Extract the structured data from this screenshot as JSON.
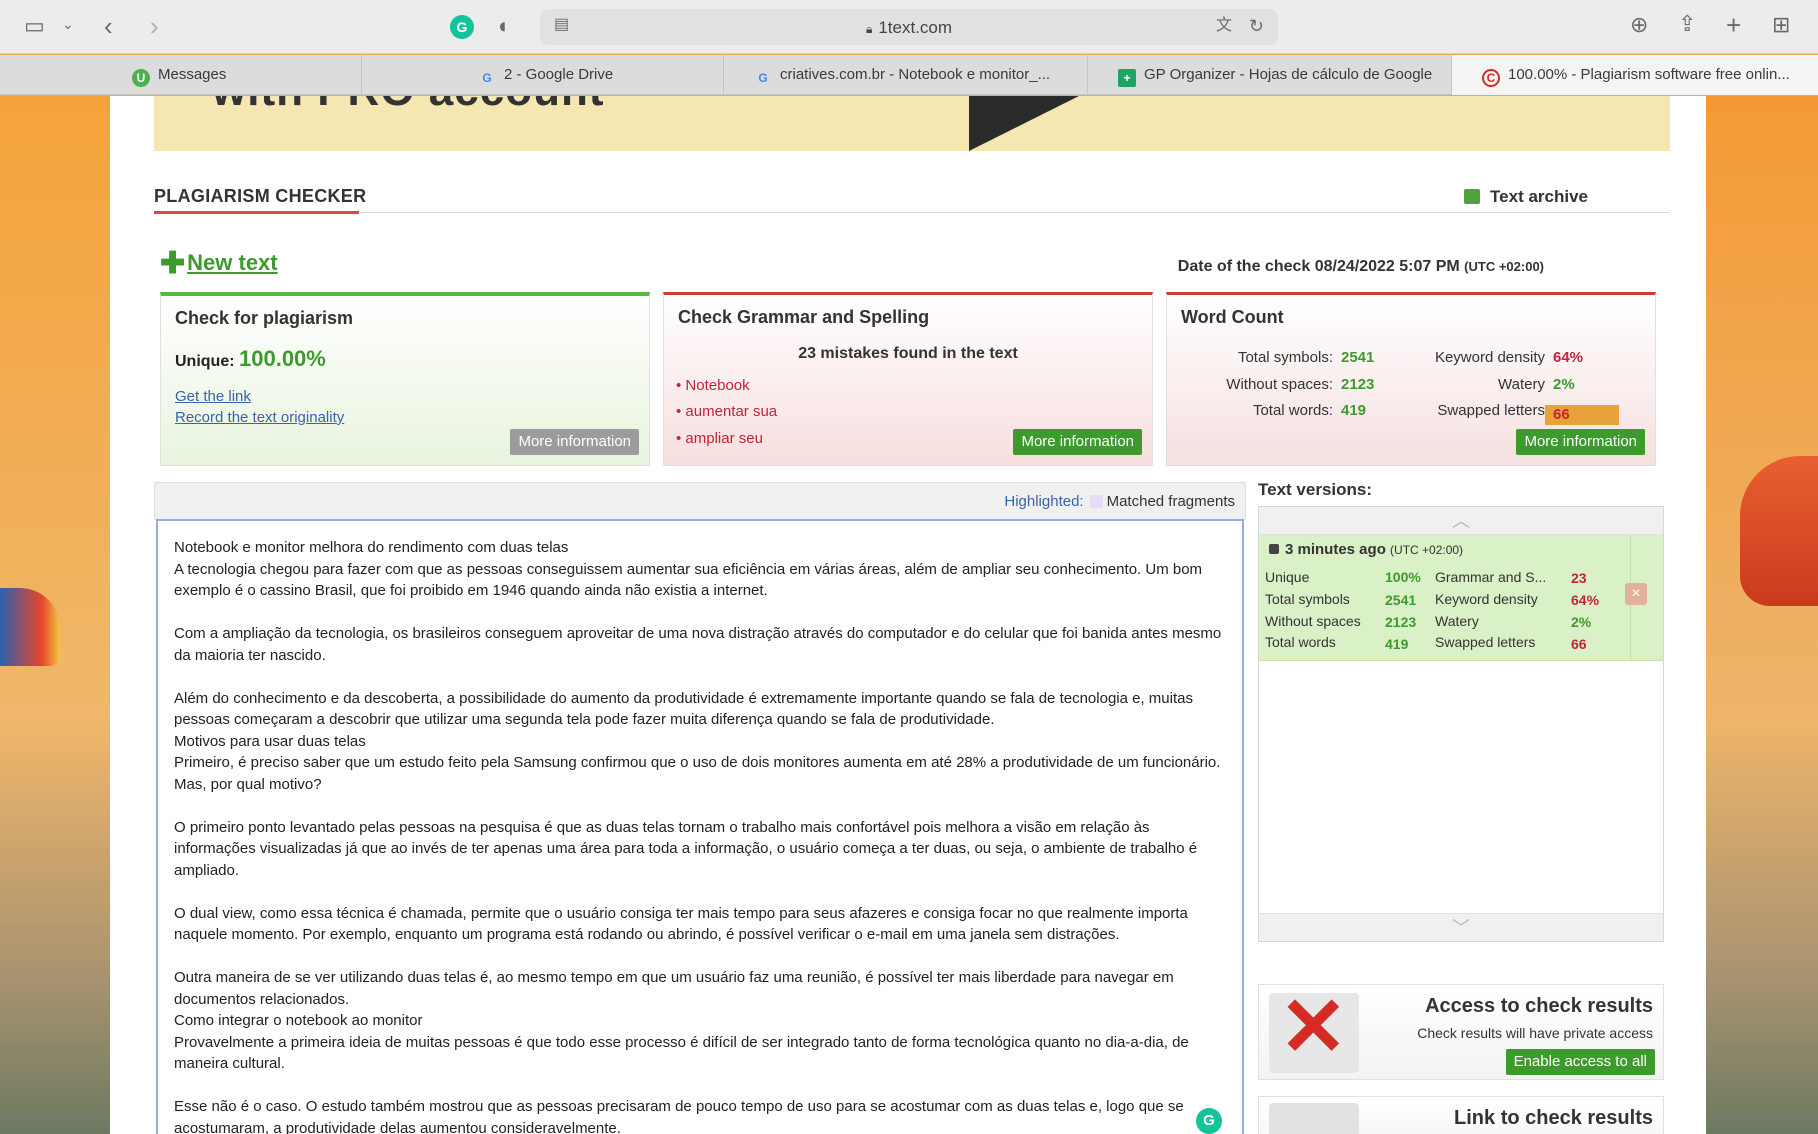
{
  "browser": {
    "url": "1text.com",
    "tabs": [
      {
        "label": "Messages",
        "icon": "messages-icon"
      },
      {
        "label": "2 - Google Drive",
        "icon": "google-icon"
      },
      {
        "label": "criatives.com.br - Notebook e monitor_...",
        "icon": "google-icon"
      },
      {
        "label": "GP Organizer - Hojas de cálculo de Google",
        "icon": "sheets-icon"
      },
      {
        "label": "100.00% - Plagiarism software free onlin...",
        "icon": "copyright-icon"
      }
    ]
  },
  "banner": {
    "text": "with PRO account"
  },
  "header": {
    "title": "PLAGIARISM CHECKER",
    "archive_label": "Text archive",
    "new_text_label": "New text",
    "date_label": "Date of the check 08/24/2022 5:07 PM",
    "timezone": "(UTC +02:00)"
  },
  "plagiarism": {
    "title": "Check for plagiarism",
    "unique_label": "Unique:",
    "unique_value": "100.00%",
    "link1": "Get the link",
    "link2": "Record the text originality",
    "more": "More information"
  },
  "grammar": {
    "title": "Check Grammar and Spelling",
    "summary": "23 mistakes found in the text",
    "mistakes": [
      "Notebook",
      "aumentar sua",
      "ampliar seu"
    ],
    "more": "More information"
  },
  "word_count": {
    "title": "Word Count",
    "total_symbols_label": "Total symbols:",
    "total_symbols": "2541",
    "without_spaces_label": "Without spaces:",
    "without_spaces": "2123",
    "total_words_label": "Total words:",
    "total_words": "419",
    "keyword_density_label": "Keyword density",
    "keyword_density": "64%",
    "watery_label": "Watery",
    "watery": "2%",
    "swapped_label": "Swapped letters",
    "swapped": "66",
    "more": "More information"
  },
  "highlight": {
    "label": "Highlighted:",
    "matched": "Matched fragments"
  },
  "text": [
    "Notebook e monitor melhora do rendimento com duas telas",
    "A tecnologia chegou para fazer com que as pessoas conseguissem aumentar sua eficiência em várias áreas, além de ampliar seu conhecimento. Um bom exemplo é o cassino Brasil, que foi proibido em 1946 quando ainda não existia a internet.",
    "",
    "Com a ampliação da tecnologia, os brasileiros conseguem aproveitar de uma nova distração através do computador e do celular que foi banida antes mesmo da maioria ter nascido.",
    "",
    "Além do conhecimento e da descoberta, a possibilidade do aumento da produtividade é extremamente importante quando se fala de tecnologia e, muitas pessoas começaram a descobrir que utilizar uma segunda tela pode fazer muita diferença quando se fala de produtividade.",
    "Motivos para usar duas telas",
    "Primeiro, é preciso saber que um estudo feito pela Samsung confirmou que o uso de dois monitores aumenta em até 28% a produtividade de um funcionário. Mas, por qual motivo?",
    "",
    "O primeiro ponto levantado pelas pessoas na pesquisa é que as duas telas tornam o trabalho mais confortável pois melhora a visão em relação às informações visualizadas já que ao invés de ter apenas uma área para toda a informação, o usuário começa a ter duas, ou seja, o ambiente de trabalho é ampliado.",
    "",
    "O dual view, como essa técnica é chamada, permite que o usuário consiga ter mais tempo para seus afazeres e consiga focar no que realmente importa naquele momento. Por exemplo, enquanto um programa está rodando ou abrindo, é possível verificar o e-mail em uma janela sem distrações.",
    "",
    "Outra maneira de se ver utilizando duas telas é, ao mesmo tempo em que um usuário faz uma reunião, é possível ter mais liberdade para navegar em documentos relacionados.",
    "Como integrar o notebook ao monitor",
    "Provavelmente a primeira ideia de muitas pessoas é que todo esse processo é difícil de ser integrado tanto de forma tecnológica quanto no dia-a-dia, de maneira cultural.",
    "",
    "Esse não é o caso. O estudo também mostrou que as pessoas precisaram de pouco tempo de uso para se acostumar com as duas telas e, logo que se acostumaram, a produtividade delas aumentou consideravelmente."
  ],
  "versions": {
    "title": "Text versions:",
    "entry": {
      "time": "3 minutes ago",
      "timezone": "(UTC +02:00)",
      "unique_label": "Unique",
      "unique": "100%",
      "total_symbols_label": "Total symbols",
      "total_symbols": "2541",
      "without_spaces_label": "Without spaces",
      "without_spaces": "2123",
      "total_words_label": "Total words",
      "total_words": "419",
      "grammar_label": "Grammar and S...",
      "grammar": "23",
      "keyword_label": "Keyword density",
      "keyword": "64%",
      "watery_label": "Watery",
      "watery": "2%",
      "swapped_label": "Swapped letters",
      "swapped": "66"
    }
  },
  "promo_access": {
    "title": "Access to check results",
    "subtitle": "Check results will have private access",
    "button": "Enable access to all"
  },
  "promo_link": {
    "title": "Link to check results"
  },
  "colors": {
    "accent_green": "#3d9b2d",
    "accent_red": "#c2243a",
    "link_blue": "#3a63a8"
  }
}
